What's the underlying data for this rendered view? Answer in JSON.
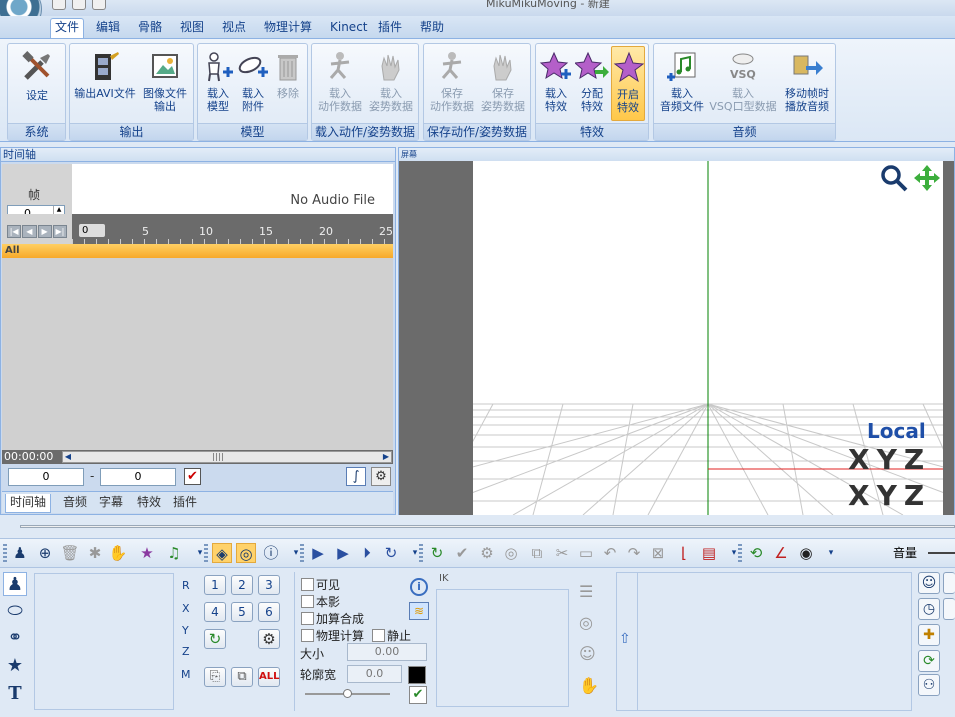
{
  "window": {
    "title": "MikuMikuMoving - 新建"
  },
  "menu": [
    {
      "label": "文件",
      "active": true
    },
    {
      "label": "编辑"
    },
    {
      "label": "骨骼"
    },
    {
      "label": "视图"
    },
    {
      "label": "视点"
    },
    {
      "label": "物理计算"
    },
    {
      "label": "Kinect"
    },
    {
      "label": "插件"
    },
    {
      "label": "帮助"
    }
  ],
  "ribbon": {
    "groups": [
      {
        "label": "系统",
        "buttons": [
          {
            "l1": "设定",
            "l2": ""
          }
        ]
      },
      {
        "label": "输出",
        "buttons": [
          {
            "l1": "输出AVI文件",
            "l2": ""
          },
          {
            "l1": "图像文件",
            "l2": "输出"
          }
        ]
      },
      {
        "label": "模型",
        "buttons": [
          {
            "l1": "载入",
            "l2": "模型"
          },
          {
            "l1": "载入",
            "l2": "附件"
          },
          {
            "l1": "移除",
            "l2": ""
          }
        ]
      },
      {
        "label": "载入动作/姿势数据",
        "buttons": [
          {
            "l1": "载入",
            "l2": "动作数据"
          },
          {
            "l1": "载入",
            "l2": "姿势数据"
          }
        ]
      },
      {
        "label": "保存动作/姿势数据",
        "buttons": [
          {
            "l1": "保存",
            "l2": "动作数据"
          },
          {
            "l1": "保存",
            "l2": "姿势数据"
          }
        ]
      },
      {
        "label": "特效",
        "buttons": [
          {
            "l1": "载入",
            "l2": "特效"
          },
          {
            "l1": "分配",
            "l2": "特效"
          },
          {
            "l1": "开启",
            "l2": "特效"
          }
        ]
      },
      {
        "label": "音频",
        "buttons": [
          {
            "l1": "载入",
            "l2": "音频文件"
          },
          {
            "l1": "载入",
            "l2": "VSQ口型数据"
          },
          {
            "l1": "移动帧时",
            "l2": "播放音频"
          }
        ]
      }
    ]
  },
  "timeline": {
    "panel_title": "时间轴",
    "frame_label": "帧",
    "frame_value": "0",
    "no_audio": "No Audio File",
    "ruler_marks": [
      "0",
      "5",
      "10",
      "15",
      "20",
      "25"
    ],
    "marker": "0",
    "all_row": "All",
    "time": "00:00:00",
    "range_start": "0",
    "range_sep": "-",
    "range_end": "0",
    "tabs": [
      "时间轴",
      "音频",
      "字幕",
      "特效",
      "插件"
    ]
  },
  "viewport": {
    "panel_title": "屏幕",
    "local_label": "Local",
    "axes_top": [
      "X",
      "Y",
      "Z"
    ],
    "axes_bottom": [
      "X",
      "Y",
      "Z"
    ]
  },
  "toolbar": {
    "volume_label": "音量"
  },
  "bottom": {
    "axis_labels": [
      "R",
      "X",
      "Y",
      "Z",
      "M"
    ],
    "num_buttons": [
      "1",
      "2",
      "3",
      "4",
      "5",
      "6"
    ],
    "all_button": "ALL",
    "checks": {
      "visible": "可见",
      "shadow": "本影",
      "add_blend": "加算合成",
      "physics": "物理计算",
      "static": "静止"
    },
    "size_label": "大小",
    "size_value": "0.00",
    "outline_label": "轮廓宽",
    "outline_value": "0.0",
    "ik_label": "IK"
  },
  "colors": {
    "accent": "#15428b",
    "axis_red": "#e02020",
    "axis_green": "#008000",
    "local_blue": "#1f4fa8"
  }
}
